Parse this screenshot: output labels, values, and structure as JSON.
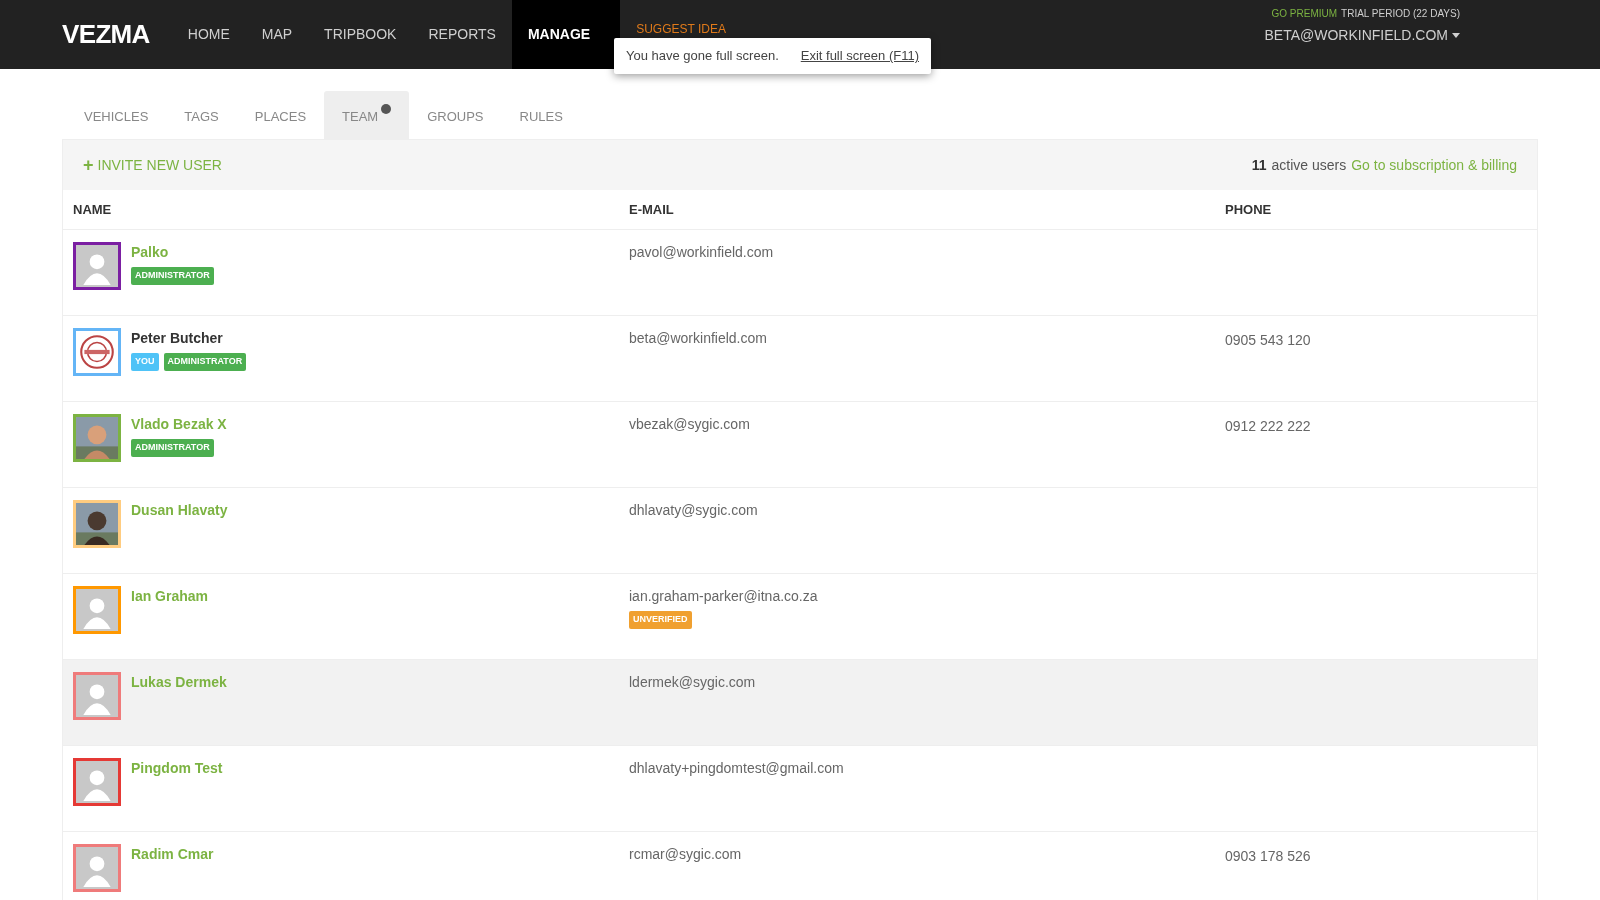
{
  "navbar": {
    "logo": "VEZMA",
    "items": [
      {
        "label": "HOME",
        "selected": false
      },
      {
        "label": "MAP",
        "selected": false
      },
      {
        "label": "TRIPBOOK",
        "selected": false
      },
      {
        "label": "REPORTS",
        "selected": false
      },
      {
        "label": "MANAGE",
        "selected": true
      }
    ],
    "suggest": "SUGGEST IDEA",
    "premium": "GO PREMIUM",
    "trial": "TRIAL PERIOD (22 DAYS)",
    "account": "BETA@WORKINFIELD.COM"
  },
  "fullscreen_notice": {
    "message": "You have gone full screen.",
    "link": "Exit full screen (F11)"
  },
  "tabs": [
    {
      "label": "VEHICLES",
      "selected": false
    },
    {
      "label": "TAGS",
      "selected": false
    },
    {
      "label": "PLACES",
      "selected": false
    },
    {
      "label": "TEAM",
      "selected": true,
      "info": true
    },
    {
      "label": "GROUPS",
      "selected": false
    },
    {
      "label": "RULES",
      "selected": false
    }
  ],
  "toolbar": {
    "invite_icon": "+",
    "invite": "INVITE NEW USER",
    "count": "11",
    "count_label": "active users",
    "billing_link": "Go to subscription & billing"
  },
  "table": {
    "columns": [
      "NAME",
      "E-MAIL",
      "PHONE"
    ],
    "rows": [
      {
        "name": "Palko",
        "current": false,
        "kind": "placeholder",
        "color": "#7b1fa2",
        "badges": [
          {
            "text": "ADMINISTRATOR",
            "kind": "role"
          }
        ],
        "email": "pavol@workinfield.com",
        "hovered": false
      },
      {
        "name": "Peter Butcher",
        "current": true,
        "color": "#64b5f6",
        "badges": [
          {
            "text": "YOU",
            "kind": "you"
          },
          {
            "text": "ADMINISTRATOR",
            "kind": "role"
          }
        ],
        "email": "beta@workinfield.com",
        "phone": "0905 543 120",
        "hovered": false
      },
      {
        "name": "Vlado Bezak X",
        "current": false,
        "color": "#7cb342",
        "badges": [
          {
            "text": "ADMINISTRATOR",
            "kind": "role"
          }
        ],
        "email": "vbezak@sygic.com",
        "phone": "0912 222 222",
        "hovered": false
      },
      {
        "name": "Dusan Hlavaty",
        "current": false,
        "color": "#ffcc80",
        "badges": [],
        "email": "dhlavaty@sygic.com",
        "hovered": false
      },
      {
        "name": "Ian Graham",
        "current": false,
        "kind": "placeholder",
        "color": "#ff9800",
        "badges": [],
        "email": "ian.graham-parker@itna.co.za",
        "email_badge": "UNVERIFIED",
        "hovered": false
      },
      {
        "name": "Lukas Dermek",
        "current": false,
        "kind": "placeholder",
        "color": "#ef7b7b",
        "badges": [],
        "email": "ldermek@sygic.com",
        "hovered": true
      },
      {
        "name": "Pingdom Test",
        "current": false,
        "kind": "placeholder",
        "color": "#e53935",
        "badges": [],
        "email": "dhlavaty+pingdomtest@gmail.com",
        "hovered": false
      },
      {
        "name": "Radim Cmar",
        "current": false,
        "kind": "placeholder",
        "color": "#ef7b7b",
        "badges": [],
        "email": "rcmar@sygic.com",
        "phone": "0903 178 526",
        "hovered": false
      }
    ]
  }
}
